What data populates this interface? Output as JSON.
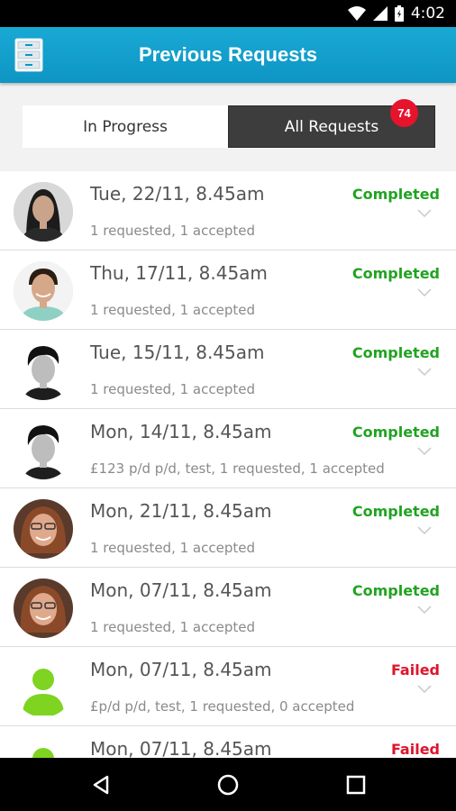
{
  "status_bar": {
    "time": "4:02",
    "icons": [
      "wifi-icon",
      "signal-icon",
      "battery-icon"
    ]
  },
  "app_bar": {
    "title": "Previous Requests",
    "menu_icon": "file-cabinet-icon",
    "color": "#12a0cc"
  },
  "tabs": {
    "in_progress": "In Progress",
    "all_requests": "All Requests",
    "badge_count": "74",
    "selected": "all_requests"
  },
  "requests": [
    {
      "date": "Tue, 22/11, 8.45am",
      "detail": "1 requested, 1 accepted",
      "status": "Completed",
      "avatar": "photo-woman-dark-hair"
    },
    {
      "date": "Thu, 17/11, 8.45am",
      "detail": "1 requested, 1 accepted",
      "status": "Completed",
      "avatar": "photo-man-smiling"
    },
    {
      "date": "Tue, 15/11, 8.45am",
      "detail": "1 requested, 1 accepted",
      "status": "Completed",
      "avatar": "photo-man-bw"
    },
    {
      "date": "Mon, 14/11, 8.45am",
      "detail": "£123 p/d p/d, test, 1 requested, 1 accepted",
      "status": "Completed",
      "avatar": "photo-man-bw"
    },
    {
      "date": "Mon, 21/11, 8.45am",
      "detail": "1 requested, 1 accepted",
      "status": "Completed",
      "avatar": "photo-woman-glasses"
    },
    {
      "date": "Mon, 07/11, 8.45am",
      "detail": "1 requested, 1 accepted",
      "status": "Completed",
      "avatar": "photo-woman-glasses"
    },
    {
      "date": "Mon, 07/11, 8.45am",
      "detail": "£p/d p/d, test, 1 requested, 0 accepted",
      "status": "Failed",
      "avatar": "default-user-icon"
    },
    {
      "date": "Mon, 07/11, 8.45am",
      "detail": "",
      "status": "Failed",
      "avatar": "default-user-icon"
    }
  ],
  "colors": {
    "completed": "#21a321",
    "failed": "#e0142c",
    "badge": "#e5132c"
  },
  "nav_bar": {
    "icons": [
      "back-icon",
      "home-icon",
      "recents-icon"
    ]
  }
}
